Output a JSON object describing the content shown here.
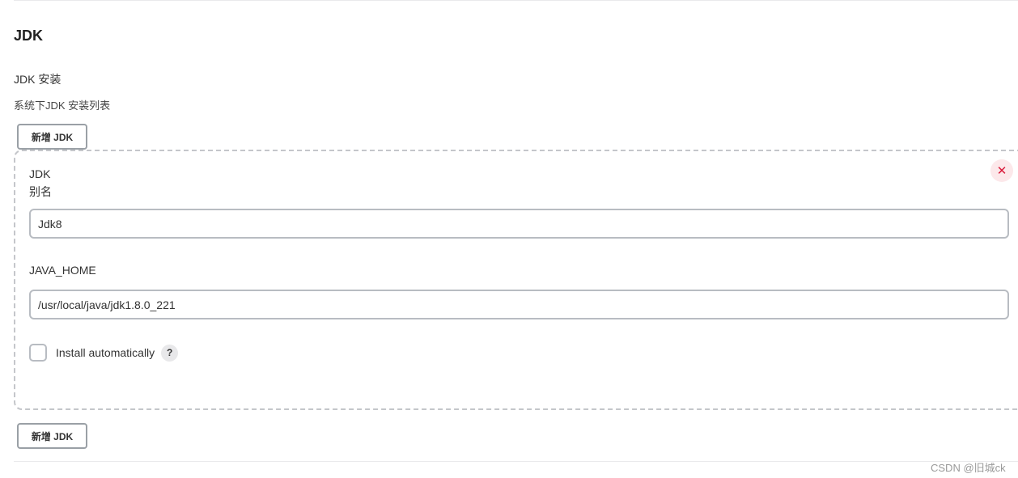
{
  "section": {
    "title": "JDK",
    "installations_label": "JDK 安装",
    "installations_description": "系统下JDK 安装列表",
    "add_button_label": "新增 JDK"
  },
  "jdk_entry": {
    "heading": "JDK",
    "alias_label": "别名",
    "alias_value": "Jdk8",
    "java_home_label": "JAVA_HOME",
    "java_home_value": "/usr/local/java/jdk1.8.0_221",
    "install_automatically_label": "Install automatically",
    "install_automatically_checked": false,
    "help_glyph": "?",
    "delete_glyph": "✕",
    "delete_icon": "close-icon"
  },
  "watermark": "CSDN @旧城ck",
  "colors": {
    "delete_accent": "#d91a3a",
    "delete_background": "#fce8ea",
    "border": "#b8bcc2"
  }
}
